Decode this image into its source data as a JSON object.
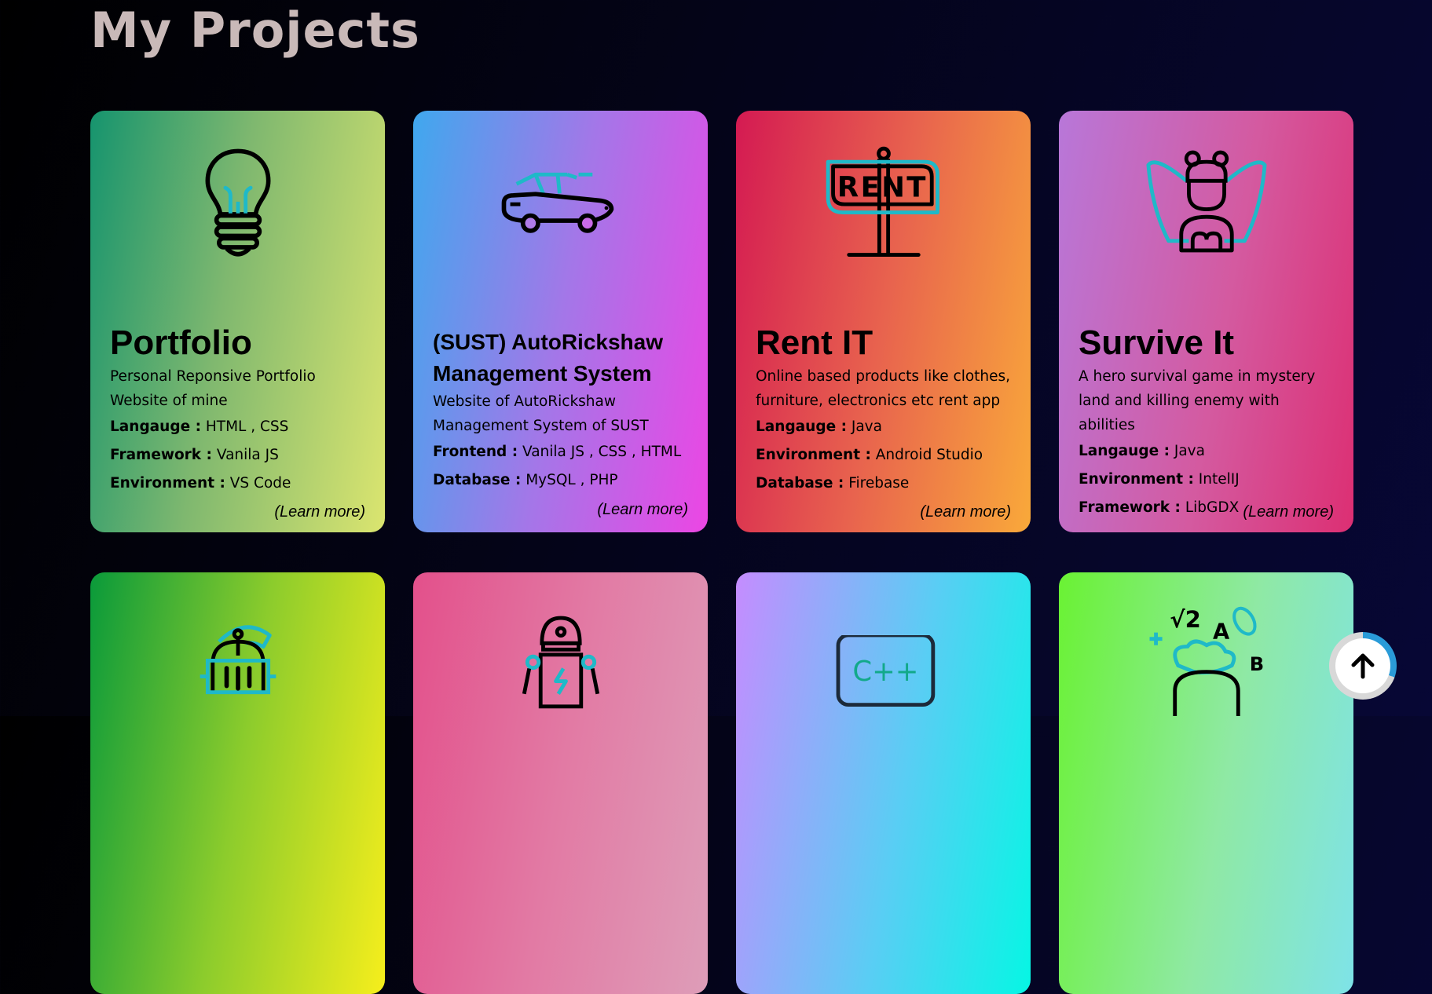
{
  "page": {
    "title": "My Projects"
  },
  "projects": [
    {
      "title": "Portfolio",
      "description": "Personal Reponsive Portfolio Website of mine",
      "props": [
        {
          "key": "Langauge :",
          "value": "HTML , CSS"
        },
        {
          "key": "Framework :",
          "value": "Vanila JS"
        },
        {
          "key": "Environment :",
          "value": "VS Code"
        }
      ],
      "link": "(Learn more)",
      "icon": "lightbulb-icon"
    },
    {
      "title": "(SUST) AutoRickshaw Management System",
      "description": "Website of AutoRickshaw Management System of SUST",
      "props": [
        {
          "key": "Frontend :",
          "value": "Vanila JS , CSS , HTML"
        },
        {
          "key": "Database :",
          "value": "MySQL , PHP"
        }
      ],
      "link": "(Learn more)",
      "icon": "car-icon"
    },
    {
      "title": "Rent IT",
      "description": "Online based products like clothes, furniture, electronics etc rent app",
      "props": [
        {
          "key": "Langauge :",
          "value": "Java"
        },
        {
          "key": "Environment :",
          "value": "Android Studio"
        },
        {
          "key": "Database :",
          "value": "Firebase"
        }
      ],
      "link": "(Learn more)",
      "icon": "rent-sign-icon",
      "icon_text": "RENT"
    },
    {
      "title": "Survive It",
      "description": "A hero survival game in mystery land and killing enemy with abilities",
      "props": [
        {
          "key": "Langauge :",
          "value": "Java"
        },
        {
          "key": "Environment :",
          "value": "IntelIJ"
        },
        {
          "key": "Framework :",
          "value": "LibGDX"
        }
      ],
      "link": "(Learn more)",
      "icon": "fairy-icon"
    }
  ],
  "second_row": [
    {
      "icon": "knight-helmet-icon"
    },
    {
      "icon": "robot-icon"
    },
    {
      "icon": "cpp-icon",
      "icon_text": "C++"
    },
    {
      "icon": "math-kid-icon",
      "icon_text": [
        "√2",
        "A",
        "B"
      ]
    }
  ],
  "scroll_top": {
    "icon": "arrow-up-icon"
  },
  "colors": {
    "accent": "#2a9bd8",
    "title": "#c9b9b8",
    "background": "#040419"
  }
}
